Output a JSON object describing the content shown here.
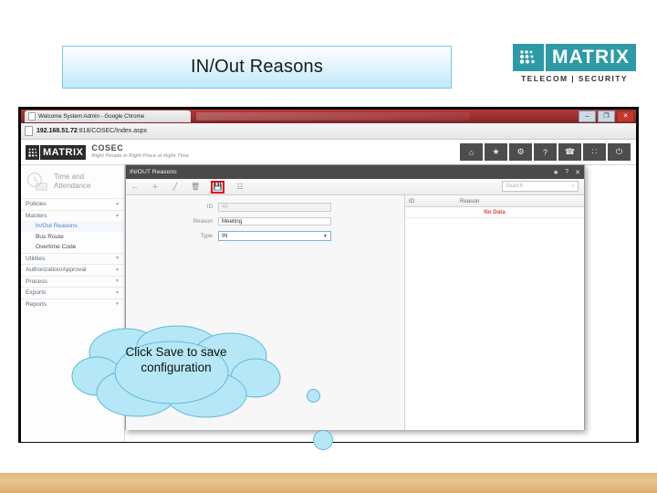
{
  "slide": {
    "title": "IN/Out Reasons",
    "brand": {
      "mark": "matrix-dots-icon",
      "word": "MATRIX",
      "subtitle": "TELECOM | SECURITY"
    }
  },
  "browser": {
    "tab_title": "Welcome System Admin - Google Chrome",
    "url_prefix": "192.168.51.72",
    "url_suffix": ":818/COSEC/Index.aspx",
    "window_controls": {
      "minimize": "–",
      "maximize": "❐",
      "close": "✕"
    }
  },
  "app_header": {
    "logo_word": "MATRIX",
    "product": "COSEC",
    "tagline": "Right People in Right Place at Right Time",
    "icons": [
      {
        "name": "home-icon",
        "glyph": "⌂"
      },
      {
        "name": "star-icon",
        "glyph": "★"
      },
      {
        "name": "gear-icon",
        "glyph": "⚙"
      },
      {
        "name": "help-icon",
        "glyph": "?"
      },
      {
        "name": "phone-icon",
        "glyph": "☎"
      },
      {
        "name": "grid-icon",
        "glyph": "∷"
      },
      {
        "name": "power-icon",
        "glyph": "⏻"
      }
    ]
  },
  "sidebar": {
    "module_title_line1": "Time and",
    "module_title_line2": "Attendance",
    "items": [
      {
        "label": "Policies",
        "caret": "▼",
        "type": "group"
      },
      {
        "label": "Masters",
        "caret": "▲",
        "type": "group"
      },
      {
        "label": "In/Out Reasons",
        "caret": "",
        "type": "sub",
        "active": true
      },
      {
        "label": "Bus Route",
        "caret": "",
        "type": "sub",
        "active": false
      },
      {
        "label": "Overtime Code",
        "caret": "",
        "type": "sub",
        "active": false
      },
      {
        "label": "Utilities",
        "caret": "▼",
        "type": "group"
      },
      {
        "label": "Authorization/Approval",
        "caret": "▼",
        "type": "group"
      },
      {
        "label": "Process",
        "caret": "▼",
        "type": "group"
      },
      {
        "label": "Exports",
        "caret": "▼",
        "type": "group"
      },
      {
        "label": "Reports",
        "caret": "▼",
        "type": "group"
      }
    ]
  },
  "dialog": {
    "title": "IN/OUT Reasons",
    "title_icons": [
      {
        "name": "favorite-icon",
        "glyph": "★"
      },
      {
        "name": "help-icon",
        "glyph": "?"
      },
      {
        "name": "close-icon",
        "glyph": "✕"
      }
    ],
    "toolbar": [
      {
        "name": "back-button",
        "glyph": "←",
        "highlighted": false
      },
      {
        "name": "add-button",
        "glyph": "＋",
        "highlighted": false
      },
      {
        "name": "edit-button",
        "glyph": "╱",
        "highlighted": false
      },
      {
        "name": "delete-button",
        "glyph": "🗑",
        "highlighted": false
      },
      {
        "name": "save-button",
        "glyph": "💾",
        "highlighted": true
      },
      {
        "name": "export-excel-button",
        "glyph": "☷",
        "highlighted": false
      }
    ],
    "search": {
      "placeholder": "Search",
      "icon": "search-icon",
      "icon_glyph": "⌕"
    },
    "form": {
      "fields": [
        {
          "label": "ID",
          "value": "40",
          "type": "text",
          "readonly": true
        },
        {
          "label": "Reason",
          "value": "Meeting",
          "type": "text",
          "readonly": false
        },
        {
          "label": "Type",
          "value": "IN",
          "type": "select",
          "arrow": "▼"
        }
      ]
    },
    "list": {
      "columns": [
        "ID",
        "Reason"
      ],
      "empty_text": "No Data",
      "empty_color": "#e8463f",
      "rows": []
    }
  },
  "callout": {
    "line1": "Click Save to save",
    "line2": "configuration",
    "fill": "#b6e7f7",
    "stroke": "#62b8d8"
  }
}
